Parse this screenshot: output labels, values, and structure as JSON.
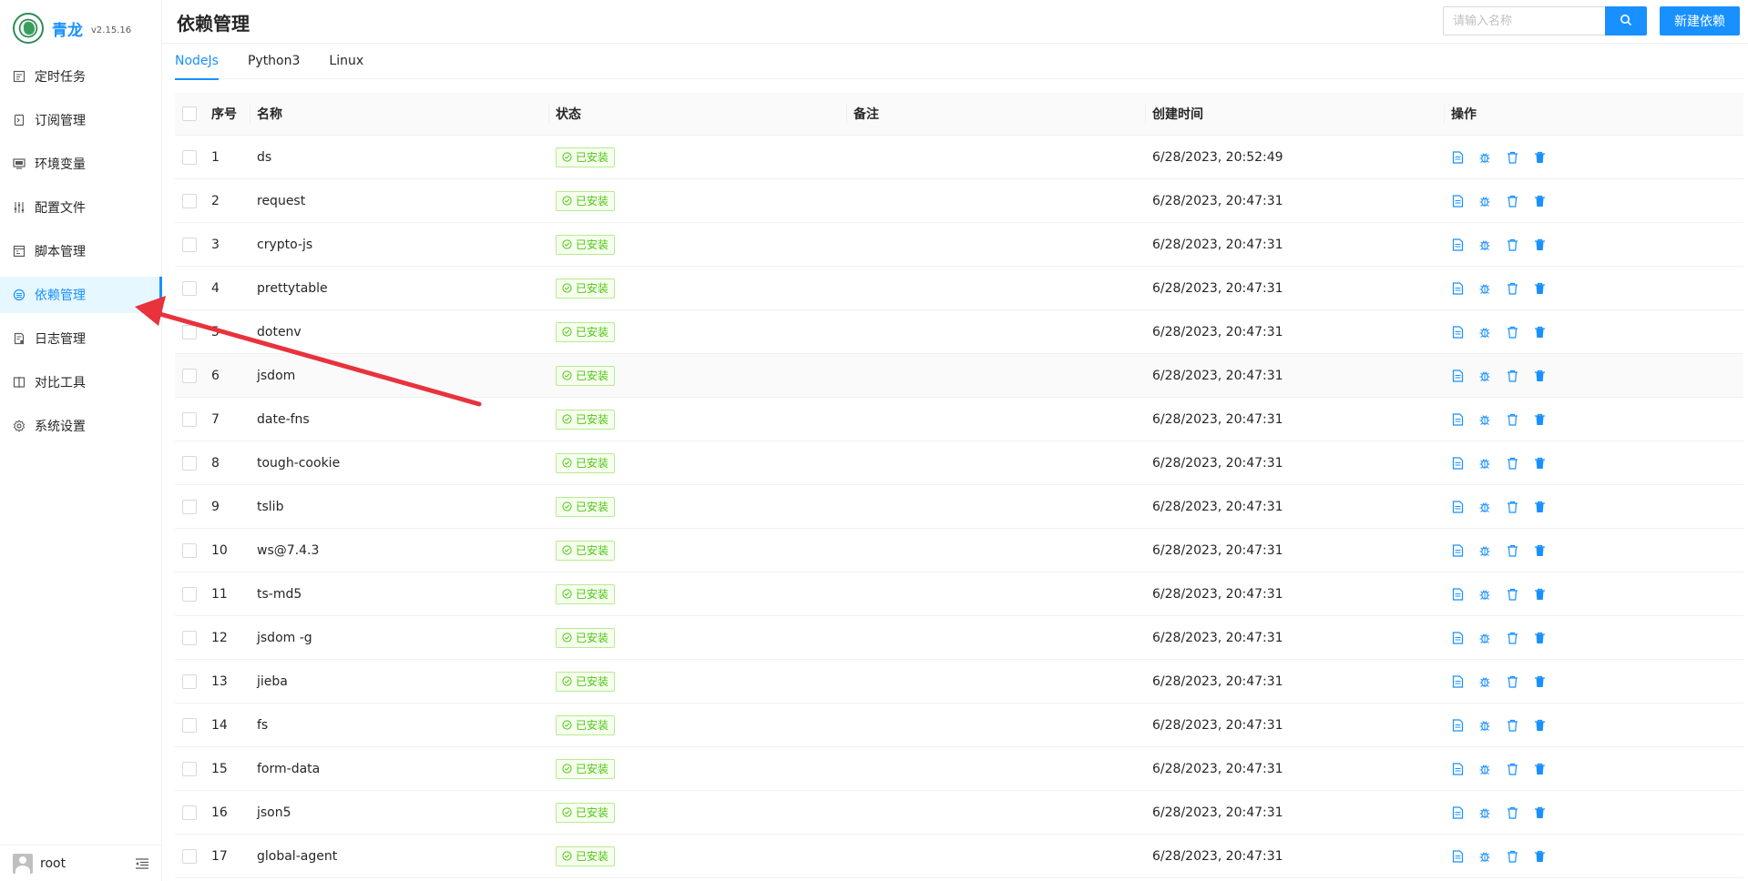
{
  "app": {
    "brand_name": "青龙",
    "version": "v2.15.16"
  },
  "sidebar": {
    "items": [
      {
        "label": "定时任务",
        "icon": "schedule-icon"
      },
      {
        "label": "订阅管理",
        "icon": "subscription-icon"
      },
      {
        "label": "环境变量",
        "icon": "env-icon"
      },
      {
        "label": "配置文件",
        "icon": "settings-sliders-icon"
      },
      {
        "label": "脚本管理",
        "icon": "script-icon"
      },
      {
        "label": "依赖管理",
        "icon": "dependency-icon",
        "active": true
      },
      {
        "label": "日志管理",
        "icon": "log-icon"
      },
      {
        "label": "对比工具",
        "icon": "diff-icon"
      },
      {
        "label": "系统设置",
        "icon": "gear-icon"
      }
    ],
    "user": "root"
  },
  "header": {
    "title": "依赖管理",
    "search_placeholder": "请输入名称",
    "new_button": "新建依赖"
  },
  "tabs": [
    {
      "label": "NodeJs",
      "active": true
    },
    {
      "label": "Python3",
      "active": false
    },
    {
      "label": "Linux",
      "active": false
    }
  ],
  "table": {
    "columns": {
      "index": "序号",
      "name": "名称",
      "status": "状态",
      "remark": "备注",
      "created": "创建时间",
      "actions": "操作"
    },
    "rows": [
      {
        "index": "1",
        "name": "ds",
        "status": "已安装",
        "remark": "",
        "created": "6/28/2023, 20:52:49"
      },
      {
        "index": "2",
        "name": "request",
        "status": "已安装",
        "remark": "",
        "created": "6/28/2023, 20:47:31"
      },
      {
        "index": "3",
        "name": "crypto-js",
        "status": "已安装",
        "remark": "",
        "created": "6/28/2023, 20:47:31"
      },
      {
        "index": "4",
        "name": "prettytable",
        "status": "已安装",
        "remark": "",
        "created": "6/28/2023, 20:47:31"
      },
      {
        "index": "5",
        "name": "dotenv",
        "status": "已安装",
        "remark": "",
        "created": "6/28/2023, 20:47:31"
      },
      {
        "index": "6",
        "name": "jsdom",
        "status": "已安装",
        "remark": "",
        "created": "6/28/2023, 20:47:31"
      },
      {
        "index": "7",
        "name": "date-fns",
        "status": "已安装",
        "remark": "",
        "created": "6/28/2023, 20:47:31"
      },
      {
        "index": "8",
        "name": "tough-cookie",
        "status": "已安装",
        "remark": "",
        "created": "6/28/2023, 20:47:31"
      },
      {
        "index": "9",
        "name": "tslib",
        "status": "已安装",
        "remark": "",
        "created": "6/28/2023, 20:47:31"
      },
      {
        "index": "10",
        "name": "ws@7.4.3",
        "status": "已安装",
        "remark": "",
        "created": "6/28/2023, 20:47:31"
      },
      {
        "index": "11",
        "name": "ts-md5",
        "status": "已安装",
        "remark": "",
        "created": "6/28/2023, 20:47:31"
      },
      {
        "index": "12",
        "name": "jsdom -g",
        "status": "已安装",
        "remark": "",
        "created": "6/28/2023, 20:47:31"
      },
      {
        "index": "13",
        "name": "jieba",
        "status": "已安装",
        "remark": "",
        "created": "6/28/2023, 20:47:31"
      },
      {
        "index": "14",
        "name": "fs",
        "status": "已安装",
        "remark": "",
        "created": "6/28/2023, 20:47:31"
      },
      {
        "index": "15",
        "name": "form-data",
        "status": "已安装",
        "remark": "",
        "created": "6/28/2023, 20:47:31"
      },
      {
        "index": "16",
        "name": "json5",
        "status": "已安装",
        "remark": "",
        "created": "6/28/2023, 20:47:31"
      },
      {
        "index": "17",
        "name": "global-agent",
        "status": "已安装",
        "remark": "",
        "created": "6/28/2023, 20:47:31"
      }
    ],
    "row_actions": [
      "file-log-icon",
      "debug-bug-icon",
      "delete-outline-icon",
      "delete-filled-icon"
    ]
  },
  "colors": {
    "primary": "#1890ff",
    "success": "#52c41a",
    "annotation_arrow": "#e8323c"
  }
}
